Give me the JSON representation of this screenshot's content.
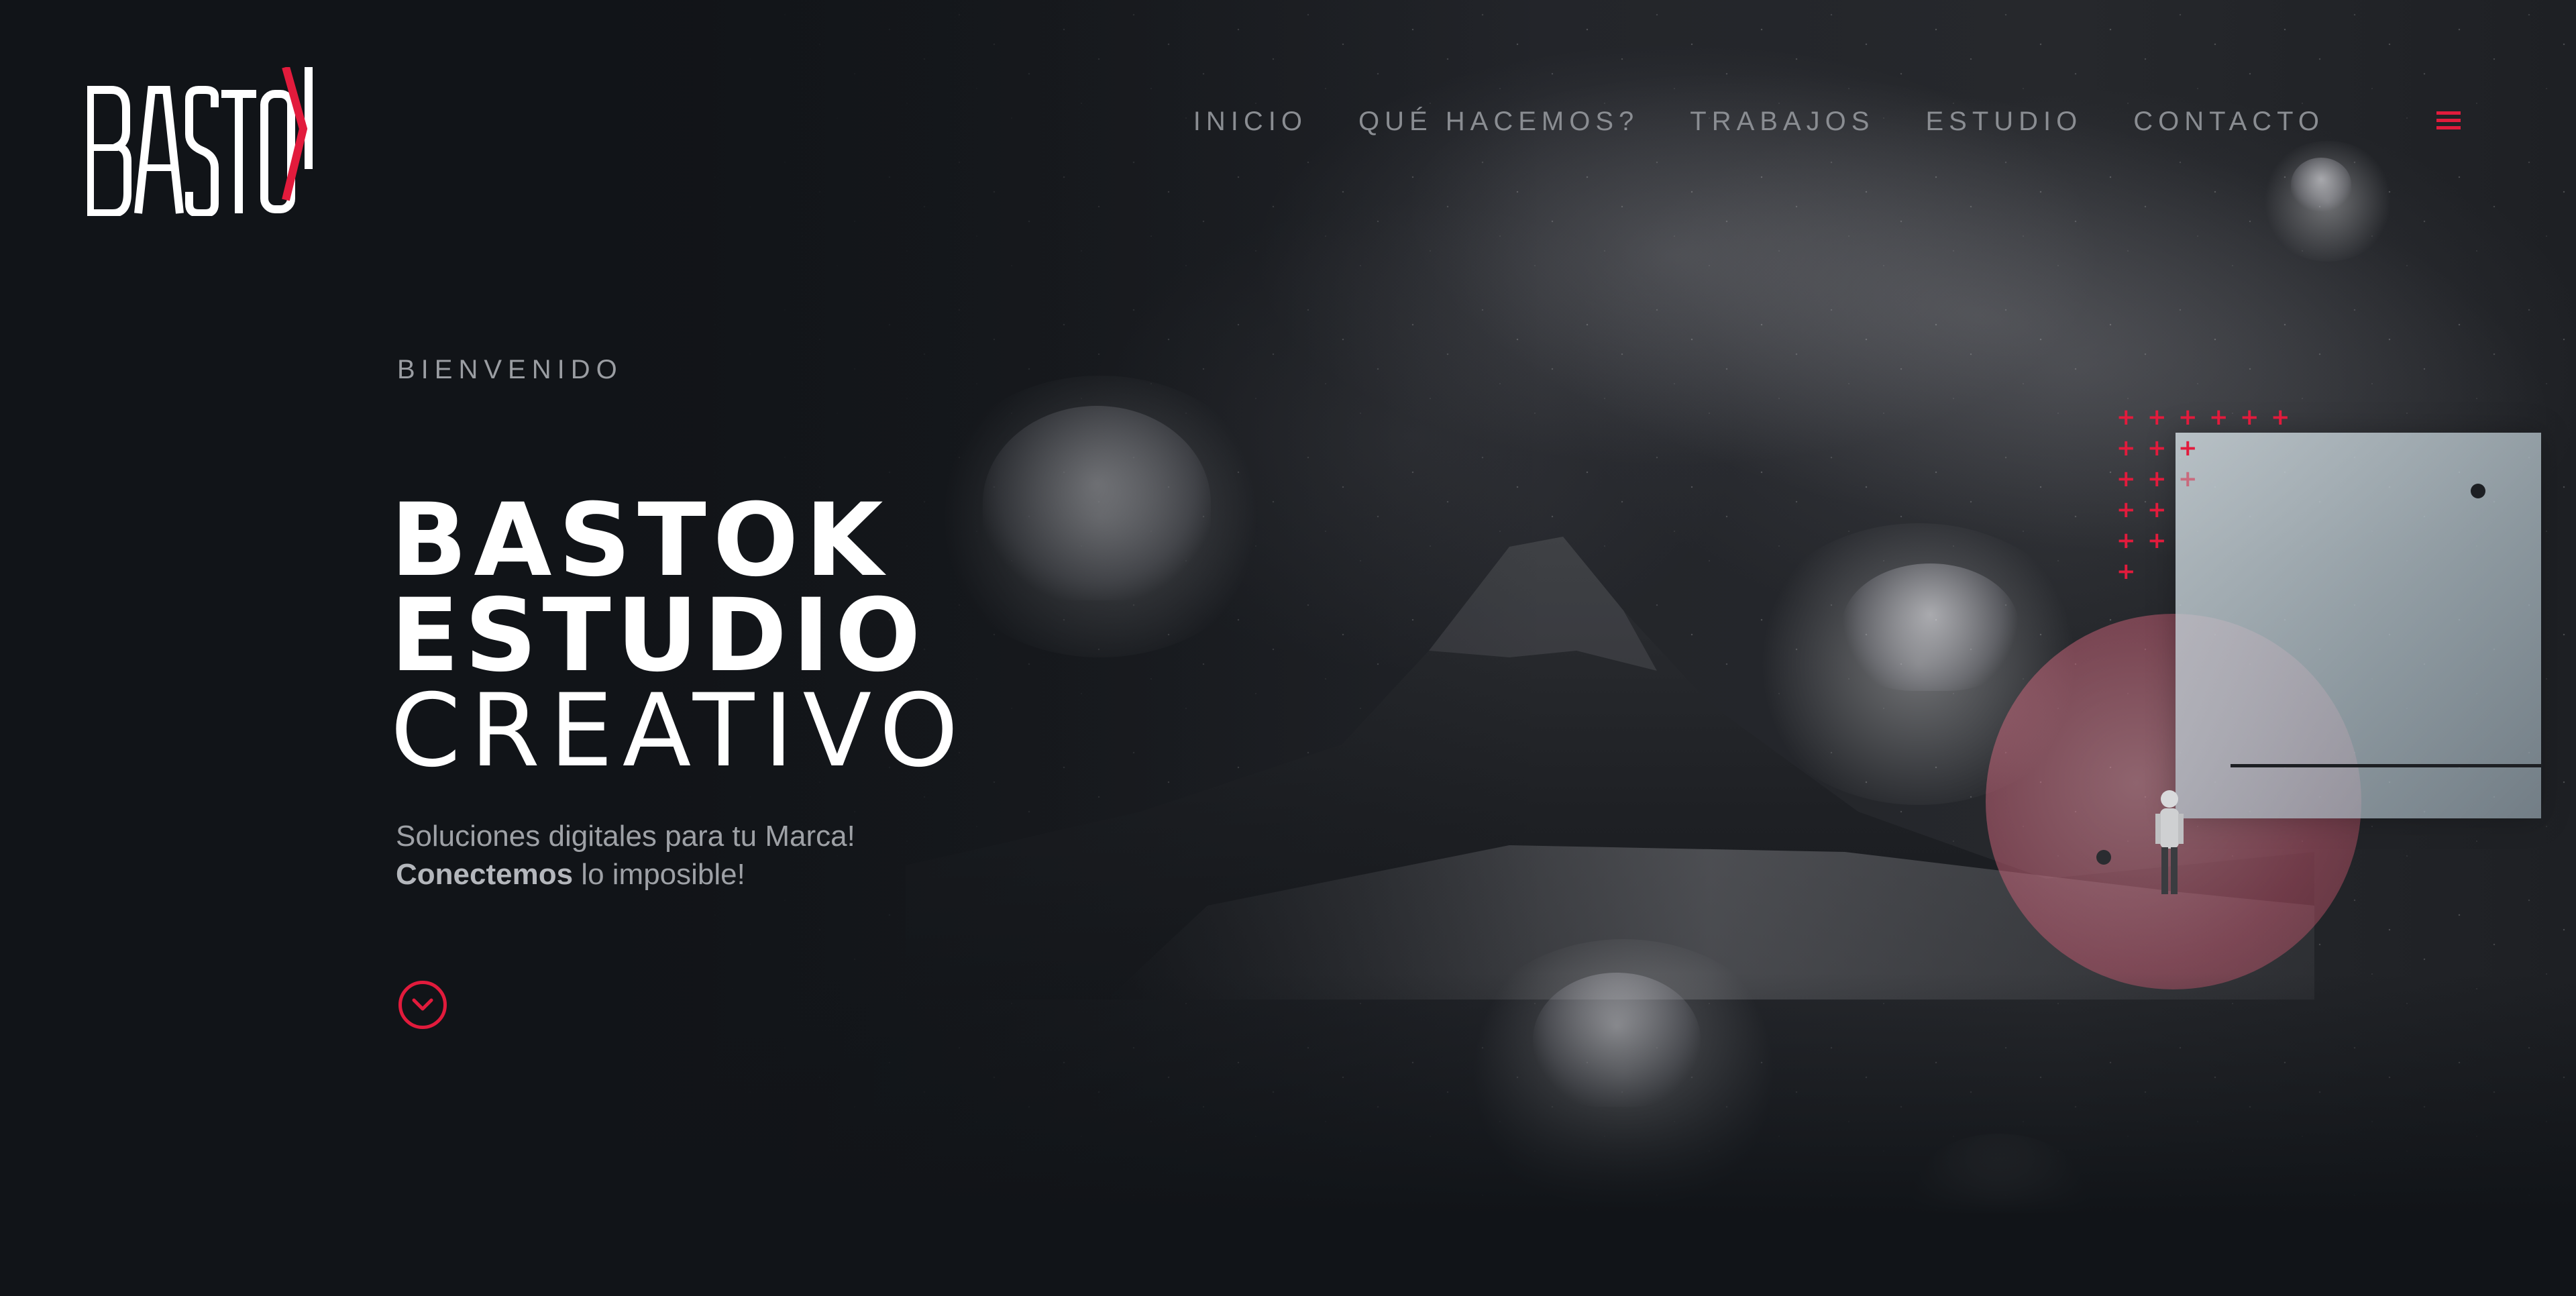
{
  "brand": {
    "logo_text": "BASTO",
    "logo_accent": "K",
    "accent_color": "#e21b3c"
  },
  "nav": {
    "items": [
      {
        "label": "INICIO"
      },
      {
        "label": "QUÉ HACEMOS?"
      },
      {
        "label": "TRABAJOS"
      },
      {
        "label": "ESTUDIO"
      },
      {
        "label": "CONTACTO"
      }
    ],
    "menu_icon": "hamburger-menu-icon"
  },
  "hero": {
    "eyebrow": "BIENVENIDO",
    "title_line1": "BASTOK",
    "title_line2": "ESTUDIO",
    "title_line3": "CREATIVO",
    "subtitle_line1": "Soluciones digitales para tu Marca!",
    "subtitle_bold": "Conectemos",
    "subtitle_rest": " lo imposible!",
    "scroll_icon": "chevron-down-circle-icon"
  }
}
